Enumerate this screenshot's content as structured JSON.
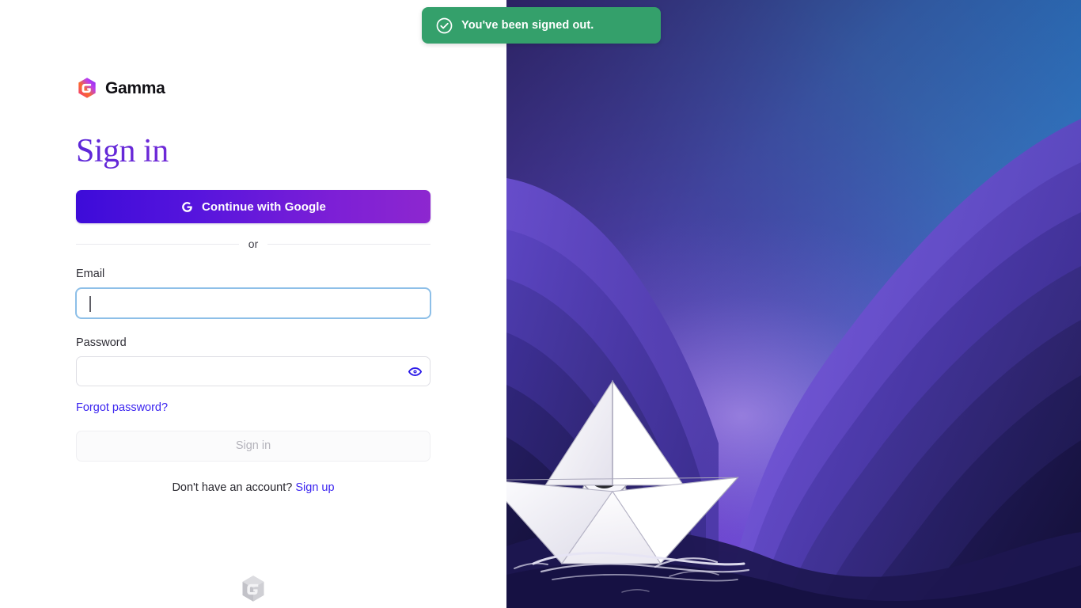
{
  "brand": {
    "name": "Gamma",
    "logo_icon": "gamma-hex-logo-icon",
    "footer_logo_icon": "gamma-hex-logo-gray-icon"
  },
  "toast": {
    "message": "You've been signed out.",
    "icon": "check-circle-icon",
    "background_color": "#34a06b",
    "text_color": "#ffffff"
  },
  "signin": {
    "title": "Sign in",
    "title_gradient_from": "#5b27d8",
    "title_gradient_to": "#9333d6",
    "google_button": {
      "label": "Continue with Google",
      "icon": "google-g-icon",
      "gradient_from": "#3d0bd9",
      "gradient_to": "#8d27cf"
    },
    "divider_label": "or",
    "email_field": {
      "label": "Email",
      "value": "",
      "placeholder": "",
      "focused": true,
      "focus_border_color": "#8dbfe8"
    },
    "password_field": {
      "label": "Password",
      "value": "",
      "placeholder": "",
      "toggle_icon": "eye-icon",
      "toggle_icon_color": "#2b1ae8"
    },
    "forgot_password_link": "Forgot password?",
    "submit_button": {
      "label": "Sign in",
      "disabled": true
    },
    "signup_prompt": "Don't have an account?",
    "signup_link": "Sign up",
    "link_color": "#3b24f0"
  },
  "artwork": {
    "description": "Astronaut sailing a white paper boat across purple layered hills",
    "sky_top_left": "#2d2465",
    "sky_bottom_left": "#7c3ae0",
    "sky_right": "#2f7fd0",
    "hill_colors": [
      "#6a4fd0",
      "#5b43c2",
      "#4b38ab",
      "#3d2e92",
      "#30257a",
      "#241c5e",
      "#1b1547"
    ],
    "boat_color": "#ffffff",
    "astronaut_visor_color": "#2b2b31"
  }
}
